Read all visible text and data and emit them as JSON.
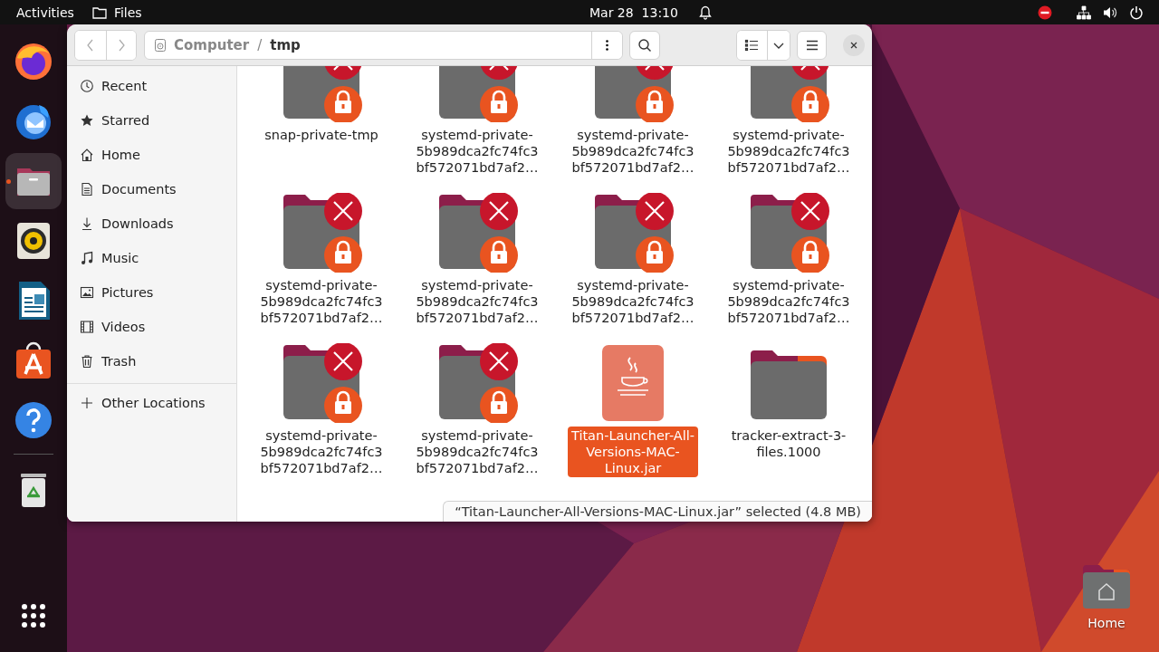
{
  "top_bar": {
    "activities": "Activities",
    "app_name": "Files",
    "clock": "Mar 28  13:10"
  },
  "dock": {
    "items": [
      {
        "kind": "firefox",
        "running": false,
        "selected": false
      },
      {
        "kind": "thunderbird",
        "running": false,
        "selected": false
      },
      {
        "kind": "files",
        "running": true,
        "selected": true
      },
      {
        "kind": "rhythmbox",
        "running": false,
        "selected": false
      },
      {
        "kind": "writer",
        "running": false,
        "selected": false
      },
      {
        "kind": "software",
        "running": false,
        "selected": false
      },
      {
        "kind": "help",
        "running": false,
        "selected": false
      },
      {
        "kind": "trash",
        "running": false,
        "selected": false
      }
    ]
  },
  "window": {
    "path_separator": "/",
    "path": [
      {
        "label": "Computer",
        "kind": "drive"
      },
      {
        "label": "tmp",
        "kind": "folder"
      }
    ],
    "sidebar": {
      "items": [
        {
          "label": "Recent",
          "kind": "recent",
          "selected": false
        },
        {
          "label": "Starred",
          "kind": "starred",
          "selected": false
        },
        {
          "label": "Home",
          "kind": "home",
          "selected": false
        },
        {
          "label": "Documents",
          "kind": "documents",
          "selected": false
        },
        {
          "label": "Downloads",
          "kind": "downloads",
          "selected": false
        },
        {
          "label": "Music",
          "kind": "music",
          "selected": false
        },
        {
          "label": "Pictures",
          "kind": "pictures",
          "selected": false
        },
        {
          "label": "Videos",
          "kind": "videos",
          "selected": false
        },
        {
          "label": "Trash",
          "kind": "trash",
          "selected": false
        }
      ],
      "other": {
        "label": "Other Locations"
      }
    },
    "files": [
      {
        "kind": "locked-folder",
        "name_lines": [
          "snap-private-tmp"
        ],
        "selected": false
      },
      {
        "kind": "locked-folder",
        "name_lines": [
          "systemd-private-",
          "5b989dca2fc74fc3",
          "bf572071bd7af2…"
        ],
        "selected": false
      },
      {
        "kind": "locked-folder",
        "name_lines": [
          "systemd-private-",
          "5b989dca2fc74fc3",
          "bf572071bd7af2…"
        ],
        "selected": false
      },
      {
        "kind": "locked-folder",
        "name_lines": [
          "systemd-private-",
          "5b989dca2fc74fc3",
          "bf572071bd7af2…"
        ],
        "selected": false
      },
      {
        "kind": "locked-folder",
        "name_lines": [
          "systemd-private-",
          "5b989dca2fc74fc3",
          "bf572071bd7af2…"
        ],
        "selected": false
      },
      {
        "kind": "locked-folder",
        "name_lines": [
          "systemd-private-",
          "5b989dca2fc74fc3",
          "bf572071bd7af2…"
        ],
        "selected": false
      },
      {
        "kind": "locked-folder",
        "name_lines": [
          "systemd-private-",
          "5b989dca2fc74fc3",
          "bf572071bd7af2…"
        ],
        "selected": false
      },
      {
        "kind": "locked-folder",
        "name_lines": [
          "systemd-private-",
          "5b989dca2fc74fc3",
          "bf572071bd7af2…"
        ],
        "selected": false
      },
      {
        "kind": "locked-folder",
        "name_lines": [
          "systemd-private-",
          "5b989dca2fc74fc3",
          "bf572071bd7af2…"
        ],
        "selected": false
      },
      {
        "kind": "locked-folder",
        "name_lines": [
          "systemd-private-",
          "5b989dca2fc74fc3",
          "bf572071bd7af2…"
        ],
        "selected": false
      },
      {
        "kind": "jar",
        "name_lines": [
          "Titan-Launcher-All-",
          "Versions-MAC-",
          "Linux.jar"
        ],
        "selected": true
      },
      {
        "kind": "folder",
        "name_lines": [
          "tracker-extract-3-",
          "files.1000"
        ],
        "selected": false
      }
    ],
    "status": "“Titan-Launcher-All-Versions-MAC-Linux.jar” selected (4.8 MB)"
  },
  "desktop_icons": [
    {
      "kind": "home-folder",
      "label": "Home"
    }
  ]
}
